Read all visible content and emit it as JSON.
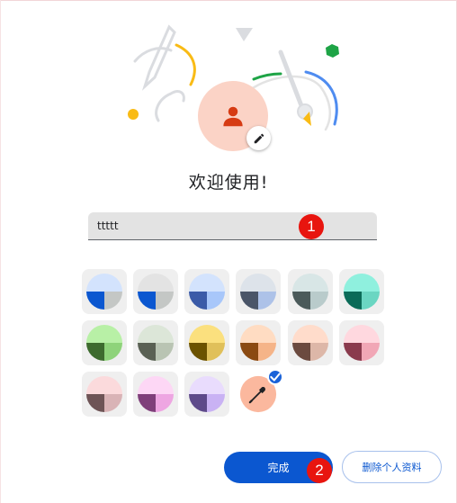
{
  "profile": {
    "welcome_text": "欢迎使用!",
    "name_value": "ttttt",
    "avatar_color": "#fbd3c6",
    "avatar_icon_color": "#d63b13"
  },
  "callouts": {
    "first": "1",
    "second": "2"
  },
  "palette": {
    "swatches": [
      {
        "top": "#d3e3fd",
        "accent": "#0b57d0",
        "light": "#c4c7c5"
      },
      {
        "top": "#e3e3e3",
        "accent": "#0b57d0",
        "light": "#c4c7c5"
      },
      {
        "top": "#d3e3fd",
        "accent": "#3b5ba8",
        "light": "#a8c7fa"
      },
      {
        "top": "#dde3ea",
        "accent": "#4a5568",
        "light": "#adc2e8"
      },
      {
        "top": "#d8e6e6",
        "accent": "#4b5a5a",
        "light": "#b9cbcb"
      },
      {
        "top": "#8ff0de",
        "accent": "#0b6b58",
        "light": "#6ad6c2"
      },
      {
        "top": "#b8f0a6",
        "accent": "#3d6b2e",
        "light": "#8ed37a"
      },
      {
        "top": "#dce6d8",
        "accent": "#5a6154",
        "light": "#b9c4b3"
      },
      {
        "top": "#fbe07e",
        "accent": "#6b5200",
        "light": "#e0c05a"
      },
      {
        "top": "#ffdcc2",
        "accent": "#8b4a12",
        "light": "#f5b488"
      },
      {
        "top": "#ffdccb",
        "accent": "#6b4a3f",
        "light": "#ddb7a8"
      },
      {
        "top": "#ffd8df",
        "accent": "#8a3a4d",
        "light": "#f1a7b6"
      },
      {
        "top": "#fbdadc",
        "accent": "#6e5456",
        "light": "#d9b3b6"
      },
      {
        "top": "#fdd7f5",
        "accent": "#7f3f7a",
        "light": "#eea6e2"
      },
      {
        "top": "#e9dcfd",
        "accent": "#5e4a8a",
        "light": "#c9b2f4"
      },
      {
        "top": "#fbb89e",
        "accent": "#fbb89e",
        "light": "#fbb89e",
        "selected": true
      }
    ]
  },
  "actions": {
    "done_label": "完成",
    "delete_label": "删除个人资料"
  },
  "colors": {
    "primary": "#0b57d0",
    "callout": "#e8150f"
  }
}
